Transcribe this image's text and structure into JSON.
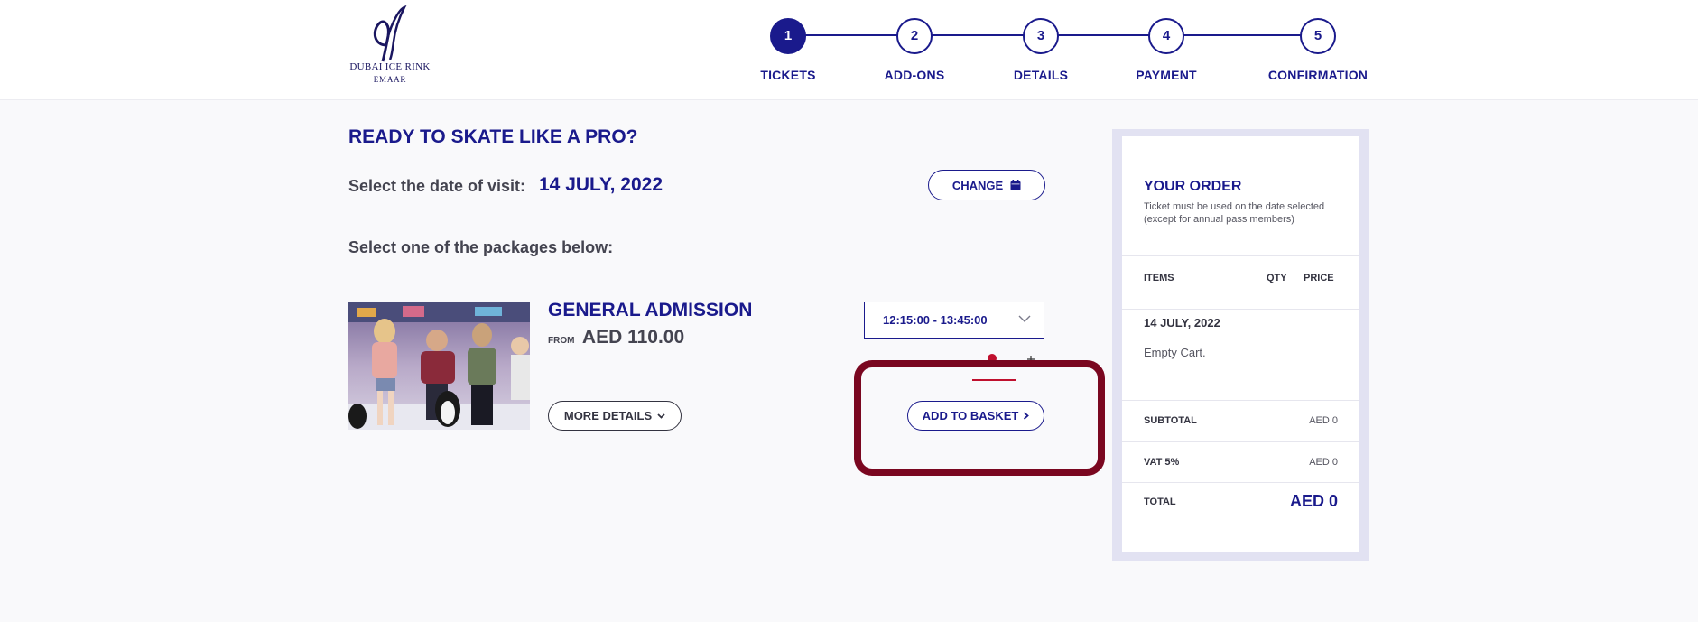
{
  "brand": {
    "name": "DUBAI ICE RINK",
    "sub": "EMAAR"
  },
  "steps": [
    {
      "num": "1",
      "label": "TICKETS",
      "active": true
    },
    {
      "num": "2",
      "label": "ADD-ONS",
      "active": false
    },
    {
      "num": "3",
      "label": "DETAILS",
      "active": false
    },
    {
      "num": "4",
      "label": "PAYMENT",
      "active": false
    },
    {
      "num": "5",
      "label": "CONFIRMATION",
      "active": false
    }
  ],
  "main": {
    "title": "READY TO SKATE LIKE A PRO?",
    "date_prompt": "Select the date of visit:",
    "date_value": "14 JULY, 2022",
    "change_label": "CHANGE",
    "packages_prompt": "Select one of the packages below:"
  },
  "package": {
    "name": "GENERAL ADMISSION",
    "from_label": "FROM",
    "price": "AED 110.00",
    "more_details_label": "MORE DETAILS",
    "time_slot": "12:15:00 - 13:45:00",
    "add_to_basket_label": "ADD TO BASKET",
    "image_icon": "family-skating-photo"
  },
  "order": {
    "title": "YOUR ORDER",
    "note": "Ticket must be used on the date selected (except for annual pass members)",
    "col_items": "ITEMS",
    "col_qty": "QTY",
    "col_price": "PRICE",
    "date": "14 JULY, 2022",
    "empty": "Empty Cart.",
    "subtotal_label": "SUBTOTAL",
    "subtotal_value": "AED 0",
    "vat_label": "VAT 5%",
    "vat_value": "AED 0",
    "total_label": "TOTAL",
    "total_value": "AED 0"
  },
  "colors": {
    "brand_navy": "#1a1a8c",
    "highlight": "#7a0720",
    "panel_border": "#e2e2f2"
  }
}
